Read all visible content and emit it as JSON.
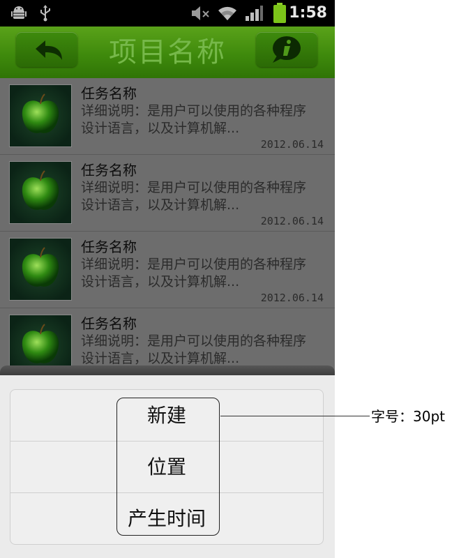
{
  "status_bar": {
    "time": "1:58",
    "icons": [
      "android-debug-icon",
      "usb-icon",
      "mute-icon",
      "wifi-icon",
      "signal-icon",
      "battery-icon"
    ]
  },
  "header": {
    "title": "项目名称",
    "back_icon": "back-arrow-icon",
    "info_icon": "info-icon",
    "color_accent": "#3f8a0c"
  },
  "list": {
    "items": [
      {
        "name": "任务名称",
        "desc": "详细说明：是用户可以使用的各种程序设计语言，以及计算机解...",
        "date": "2012.06.14"
      },
      {
        "name": "任务名称",
        "desc": "详细说明：是用户可以使用的各种程序设计语言，以及计算机解...",
        "date": "2012.06.14"
      },
      {
        "name": "任务名称",
        "desc": "详细说明：是用户可以使用的各种程序设计语言，以及计算机解...",
        "date": "2012.06.14"
      },
      {
        "name": "任务名称",
        "desc": "详细说明：是用户可以使用的各种程序设计语言，以及计算机解...",
        "date": ""
      }
    ]
  },
  "menu": {
    "items": [
      "新建",
      "位置",
      "产生时间"
    ]
  },
  "annotation": {
    "text": "字号：30pt"
  }
}
